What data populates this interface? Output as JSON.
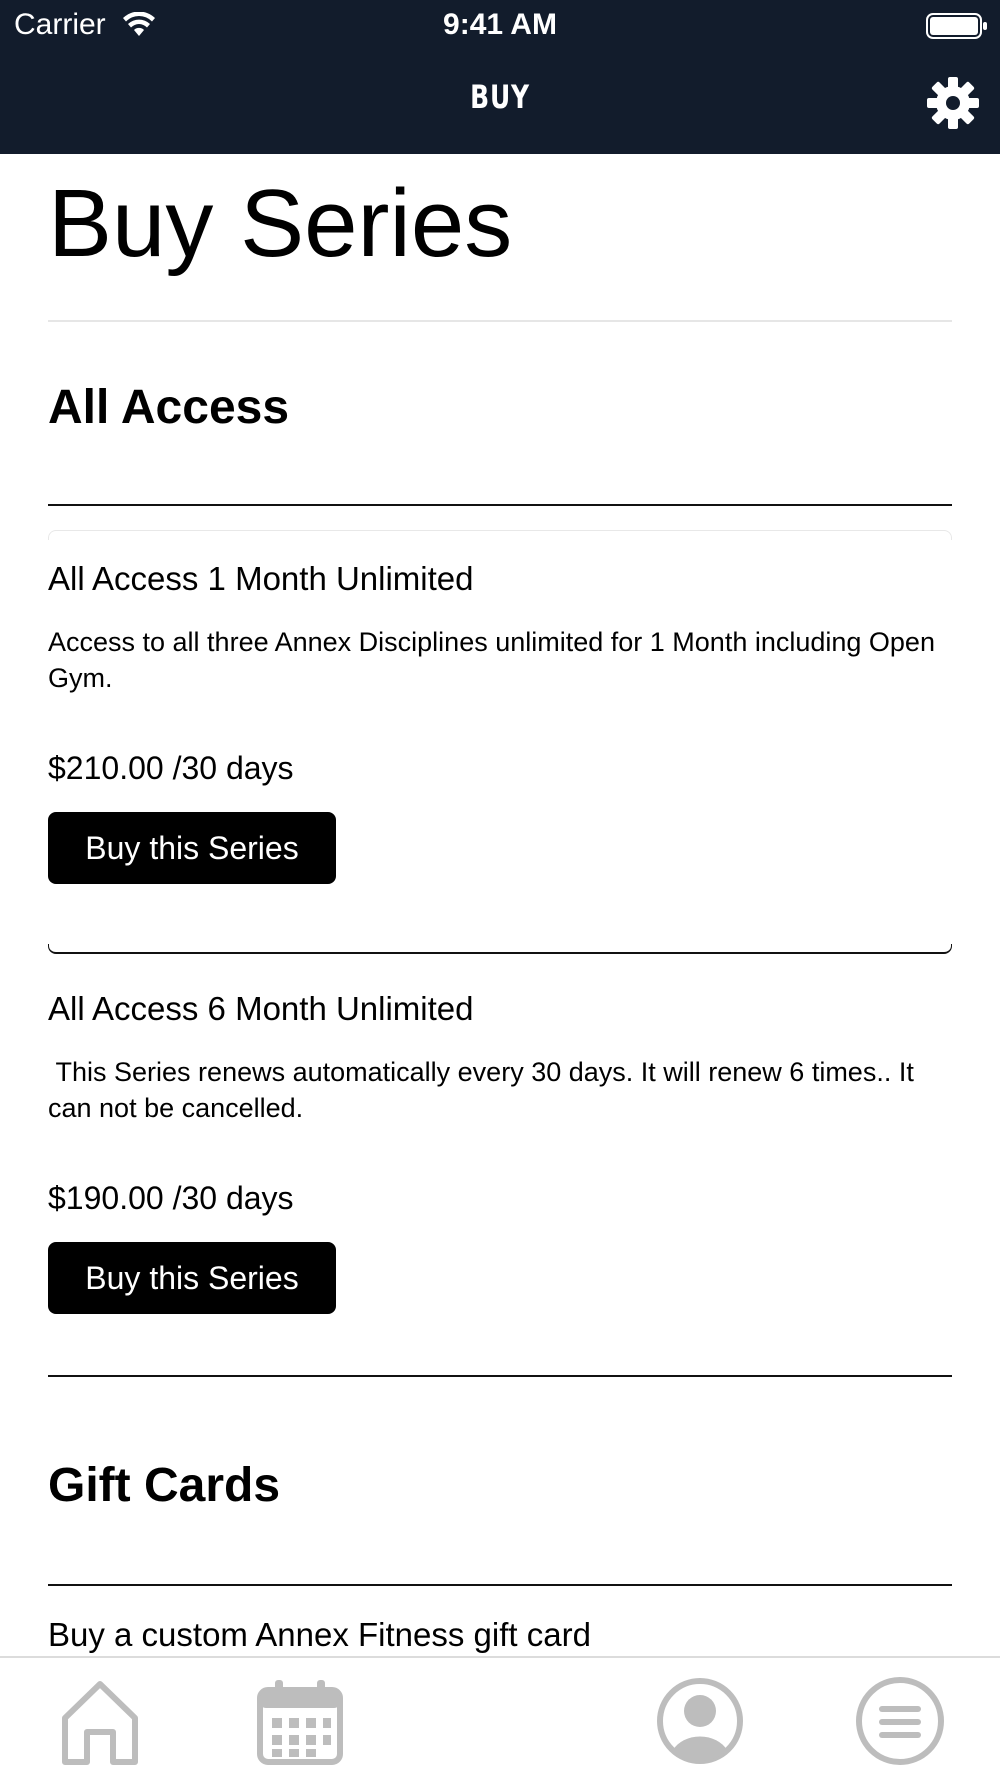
{
  "status_bar": {
    "carrier": "Carrier",
    "time": "9:41 AM"
  },
  "nav": {
    "title": "BUY"
  },
  "page": {
    "title": "Buy Series"
  },
  "sections": [
    {
      "title": "All Access",
      "items": [
        {
          "name": "All Access 1 Month Unlimited",
          "description": "Access to all three Annex Disciplines unlimited for 1 Month including Open Gym.",
          "price": "$210.00 /30 days",
          "button": "Buy this Series"
        },
        {
          "name": "All Access 6 Month Unlimited",
          "description": " This Series renews automatically every 30 days. It will renew 6 times.. It can not be cancelled.",
          "price": "$190.00 /30 days",
          "button": "Buy this Series"
        }
      ]
    },
    {
      "title": "Gift Cards",
      "text": "Buy a custom Annex Fitness gift card"
    }
  ],
  "tabbar": {
    "icons": [
      "home-icon",
      "calendar-icon",
      "profile-icon",
      "menu-icon"
    ],
    "icon_color": "#bdbdbd"
  },
  "colors": {
    "nav_background": "#121c2c",
    "button_background": "#000000",
    "button_text": "#ffffff"
  }
}
